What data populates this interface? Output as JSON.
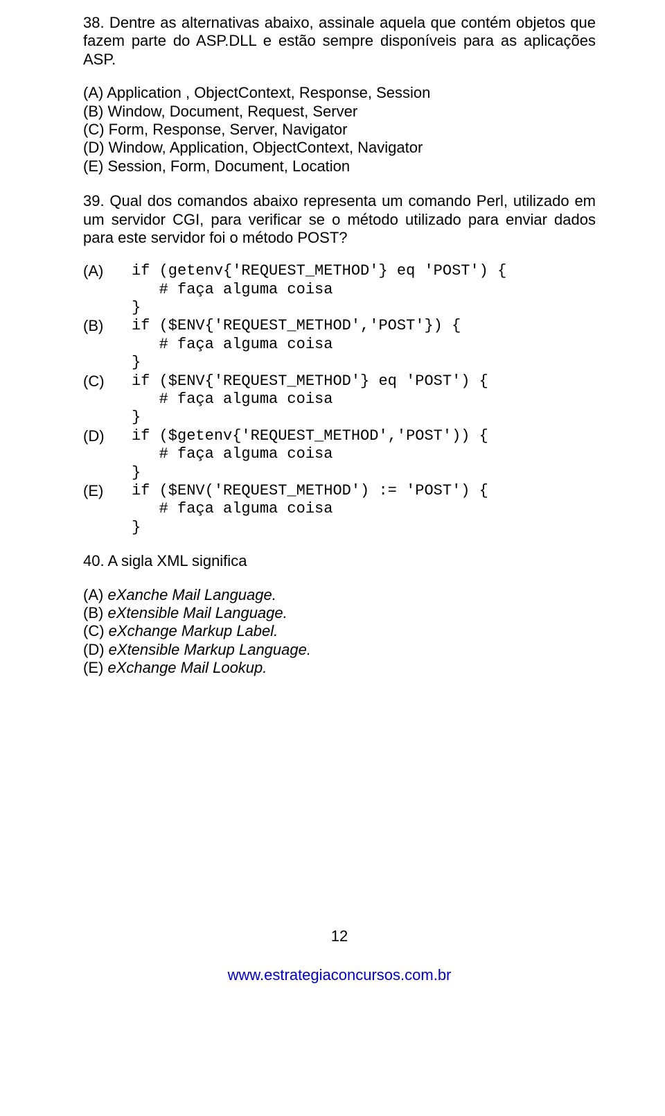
{
  "q38": {
    "text": "38. Dentre as alternativas abaixo, assinale aquela que contém objetos que fazem parte do ASP.DLL e estão sempre disponíveis para as aplicações ASP.",
    "a": "(A) Application , ObjectContext, Response, Session",
    "b": "(B) Window, Document, Request, Server",
    "c": "(C) Form, Response, Server, Navigator",
    "d": "(D) Window, Application, ObjectContext, Navigator",
    "e": "(E) Session, Form, Document, Location"
  },
  "q39": {
    "text": "39. Qual dos comandos abaixo representa um comando Perl, utilizado em um servidor CGI, para verificar se o método utilizado para enviar dados para este servidor foi o método POST?",
    "labels": {
      "a": "(A)",
      "b": "(B)",
      "c": "(C)",
      "d": "(D)",
      "e": "(E)"
    },
    "code": {
      "a": "if (getenv{'REQUEST_METHOD'} eq 'POST') {\n   # faça alguma coisa\n}",
      "b": "if ($ENV{'REQUEST_METHOD','POST'}) {\n   # faça alguma coisa\n}",
      "c": "if ($ENV{'REQUEST_METHOD'} eq 'POST') {\n   # faça alguma coisa\n}",
      "d": "if ($getenv{'REQUEST_METHOD','POST')) {\n   # faça alguma coisa\n}",
      "e": "if ($ENV('REQUEST_METHOD') := 'POST') {\n   # faça alguma coisa\n}"
    }
  },
  "q40": {
    "text": "40. A sigla XML significa",
    "a_prefix": "(A) ",
    "a_italic": "eXanche Mail Language.",
    "b_prefix": "(B) ",
    "b_italic": "eXtensible Mail Language.",
    "c_prefix": "(C) ",
    "c_italic": "eXchange Markup Label.",
    "d_prefix": "(D) ",
    "d_italic": "eXtensible Markup Language.",
    "e_prefix": "(E) ",
    "e_italic": "eXchange Mail Lookup."
  },
  "page_number": "12",
  "footer": "www.estrategiaconcursos.com.br"
}
